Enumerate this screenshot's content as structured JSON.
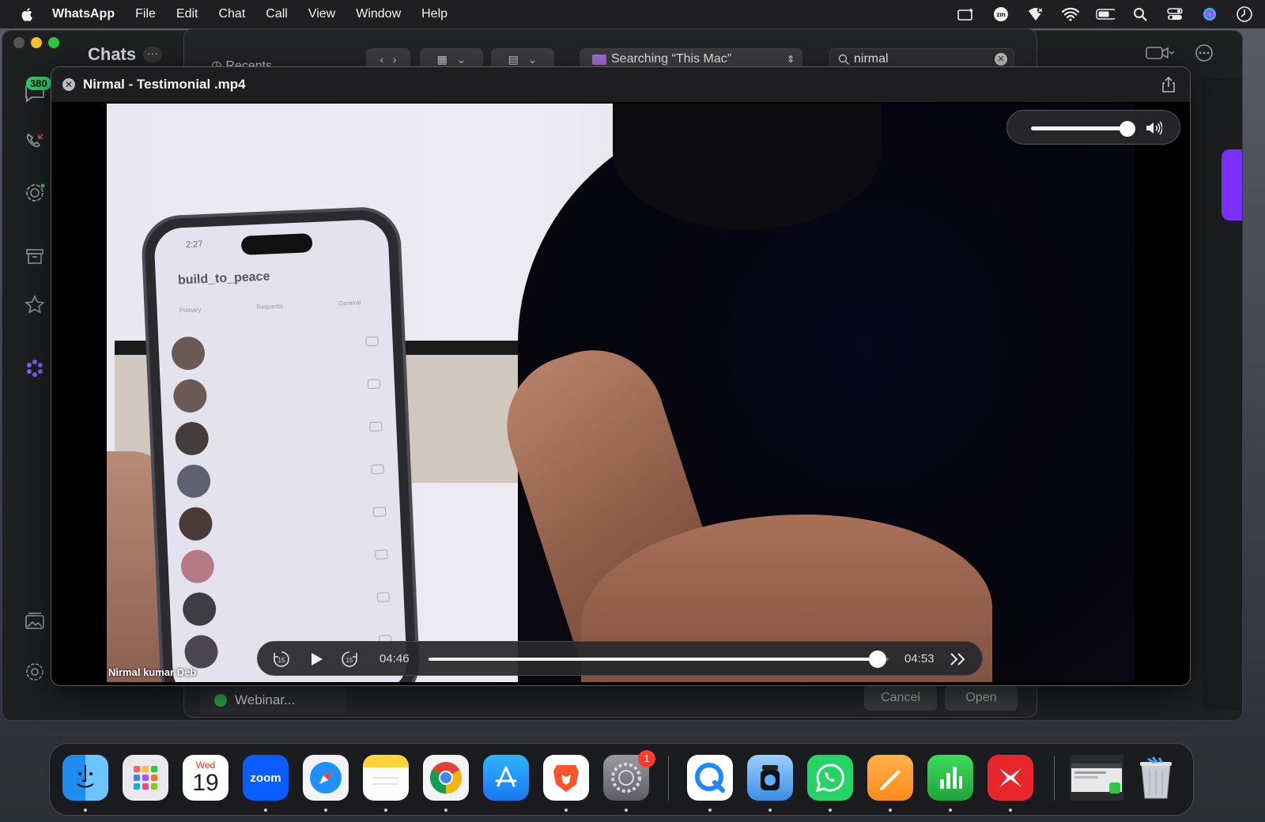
{
  "menubar": {
    "app_name": "WhatsApp",
    "items": [
      "File",
      "Edit",
      "Chat",
      "Call",
      "View",
      "Window",
      "Help"
    ],
    "status_icons": [
      "screen-share-icon",
      "zoom-icon",
      "vpn-icon",
      "wifi-icon",
      "battery-icon",
      "spotlight-search-icon",
      "control-center-icon",
      "siri-icon",
      "clock-icon"
    ]
  },
  "whatsapp": {
    "chats_title": "Chats",
    "chats_more": "···",
    "unread_badge": "380"
  },
  "finder_dialog": {
    "recents_label": "Recents",
    "search_scope": "Searching “This Mac”",
    "search_query": "nirmal",
    "bottom_tag": "Webinar...",
    "cancel_label": "Cancel",
    "open_label": "Open"
  },
  "player": {
    "title": "Nirmal - Testimonial .mp4",
    "caption": "Nirmal kumar Deb",
    "current_time": "04:46",
    "duration": "04:53",
    "progress_fraction": 0.976,
    "volume_fraction": 1.0,
    "skip_back_label": "15",
    "skip_forward_label": "15"
  },
  "video_content": {
    "phone_time": "2:27",
    "phone_handle": "build_to_peace",
    "phone_tabs": [
      "Primary",
      "Requests",
      "General"
    ]
  },
  "dock": {
    "calendar_day": "Wed",
    "calendar_date": "19",
    "zoom_label": "zoom",
    "settings_badge": "1",
    "apps": [
      "Finder",
      "Launchpad",
      "Calendar",
      "Zoom",
      "Safari",
      "Notes",
      "Chrome",
      "App Store",
      "Brave",
      "System Settings",
      "QuickTime Player",
      "Preview",
      "WhatsApp",
      "Pages",
      "Numbers",
      "Kolibri",
      "Recent Window",
      "Trash"
    ]
  },
  "colors": {
    "whatsapp_green": "#25d366",
    "badge_red": "#ff3b30",
    "accent_purple": "#7b2ff7"
  }
}
